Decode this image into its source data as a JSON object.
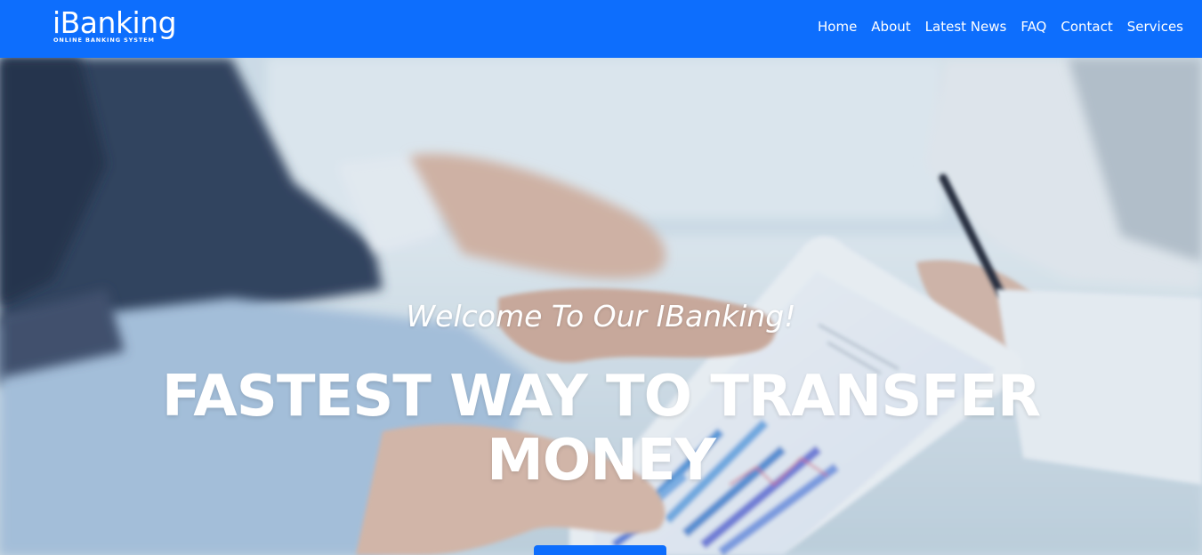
{
  "brand": {
    "name": "iBanking",
    "tagline": "ONLINE BANKING SYSTEM"
  },
  "nav": {
    "items": [
      {
        "label": "Home"
      },
      {
        "label": "About"
      },
      {
        "label": "Latest News"
      },
      {
        "label": "FAQ"
      },
      {
        "label": "Contact"
      },
      {
        "label": "Services"
      }
    ]
  },
  "hero": {
    "tagline": "Welcome To Our IBanking!",
    "title": "FASTEST WAY TO TRANSFER MONEY",
    "background_image": "business-people-with-tablet-charts",
    "cta_label": ""
  },
  "colors": {
    "primary": "#0d6efd",
    "text_on_primary": "#ffffff"
  }
}
